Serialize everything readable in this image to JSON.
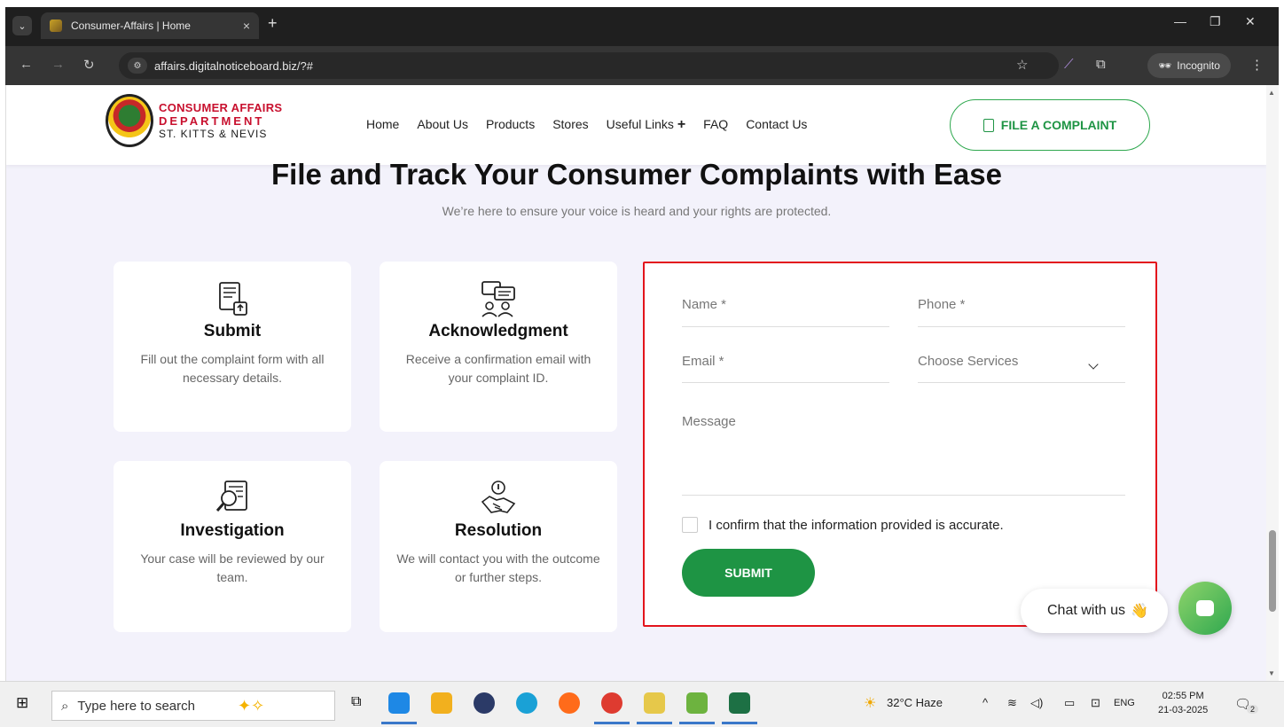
{
  "browser": {
    "tab_title": "Consumer-Affairs | Home",
    "tab_close": "×",
    "new_tab": "+",
    "url": "affairs.digitalnoticeboard.biz/?#",
    "incognito_label": "Incognito"
  },
  "header": {
    "logo": {
      "line1": "CONSUMER AFFAIRS",
      "line2": "DEPARTMENT",
      "line3": "ST. KITTS & NEVIS"
    },
    "nav": [
      "Home",
      "About Us",
      "Products",
      "Stores",
      "Useful Links",
      "FAQ",
      "Contact Us"
    ],
    "useful_links_plus": "+",
    "cta_label": "FILE A COMPLAINT"
  },
  "hero": {
    "title": "File and Track Your Consumer Complaints with Ease",
    "subtitle": "We’re here to ensure your voice is heard and your rights are protected."
  },
  "steps": [
    {
      "title": "Submit",
      "desc": "Fill out the complaint form with all necessary details."
    },
    {
      "title": "Acknowledgment",
      "desc": "Receive a confirmation email with your complaint ID."
    },
    {
      "title": "Investigation",
      "desc": "Your case will be reviewed by our team."
    },
    {
      "title": "Resolution",
      "desc": "We will contact you with the outcome or further steps."
    }
  ],
  "form": {
    "name_placeholder": "Name *",
    "phone_placeholder": "Phone *",
    "email_placeholder": "Email *",
    "services_selected": "Choose Services",
    "message_placeholder": "Message",
    "confirm_label": "I confirm that the information provided is accurate.",
    "submit_label": "SUBMIT"
  },
  "chat": {
    "label": "Chat with us",
    "emoji": "👋"
  },
  "taskbar": {
    "search_placeholder": "Type here to search",
    "weather": "32°C  Haze",
    "lang": "ENG",
    "time": "02:55 PM",
    "date": "21-03-2025",
    "notifications": "2"
  }
}
